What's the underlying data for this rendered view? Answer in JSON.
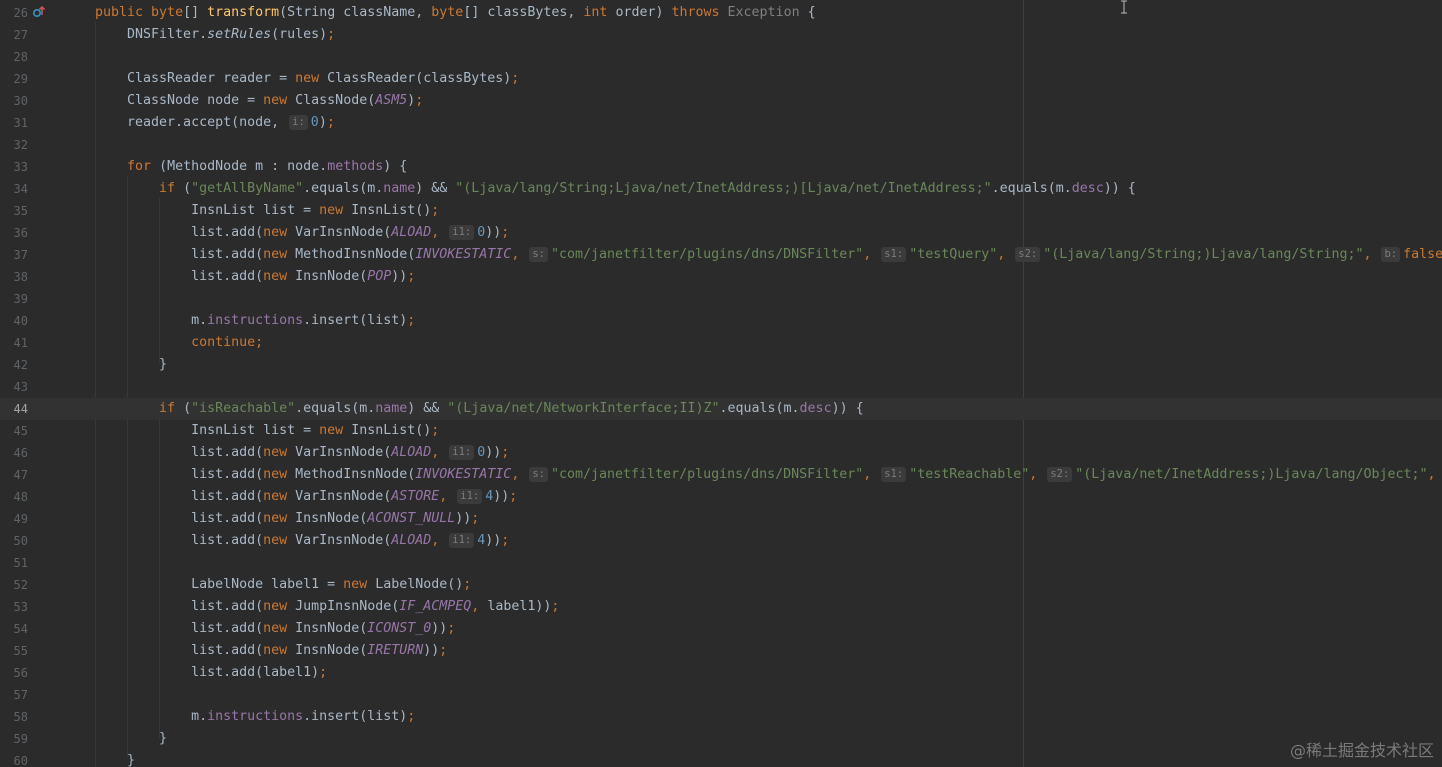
{
  "editor": {
    "watermark": "@稀土掘金技术社区",
    "current_line_index": 18,
    "gutter_icon": "implements-override-icon",
    "colors": {
      "background": "#2b2b2b",
      "keyword": "#cc7832",
      "string": "#6a8759",
      "method_declaration": "#ffc66d",
      "field": "#9876aa",
      "number": "#6897bb",
      "plain": "#a9b7c6",
      "line_number": "#606366"
    },
    "lines": [
      {
        "num": "26",
        "tokens": [
          {
            "c": "kw",
            "t": "public "
          },
          {
            "c": "kw",
            "t": "byte"
          },
          {
            "t": "[] "
          },
          {
            "c": "fn",
            "t": "transform"
          },
          {
            "t": "(String className, "
          },
          {
            "c": "kw",
            "t": "byte"
          },
          {
            "t": "[] classBytes, "
          },
          {
            "c": "kw",
            "t": "int "
          },
          {
            "t": "order) "
          },
          {
            "c": "kw",
            "t": "throws "
          },
          {
            "c": "cmt",
            "t": "Exception"
          },
          {
            "t": " {"
          }
        ]
      },
      {
        "num": "27",
        "tokens": [
          {
            "t": "    DNSFilter."
          },
          {
            "c": "st",
            "t": "setRules"
          },
          {
            "t": "(rules)"
          },
          {
            "c": "kw",
            "t": ";"
          }
        ]
      },
      {
        "num": "28",
        "tokens": []
      },
      {
        "num": "29",
        "tokens": [
          {
            "t": "    ClassReader reader = "
          },
          {
            "c": "kw",
            "t": "new "
          },
          {
            "t": "ClassReader(classBytes)"
          },
          {
            "c": "kw",
            "t": ";"
          }
        ]
      },
      {
        "num": "30",
        "tokens": [
          {
            "t": "    ClassNode node = "
          },
          {
            "c": "kw",
            "t": "new "
          },
          {
            "t": "ClassNode("
          },
          {
            "c": "cst",
            "t": "ASM5"
          },
          {
            "t": ")"
          },
          {
            "c": "kw",
            "t": ";"
          }
        ]
      },
      {
        "num": "31",
        "tokens": [
          {
            "t": "    reader.accept(node, "
          },
          {
            "c": "hint",
            "t": "i:"
          },
          {
            "c": "num",
            "t": "0"
          },
          {
            "t": ")"
          },
          {
            "c": "kw",
            "t": ";"
          }
        ]
      },
      {
        "num": "32",
        "tokens": []
      },
      {
        "num": "33",
        "tokens": [
          {
            "t": "    "
          },
          {
            "c": "kw",
            "t": "for "
          },
          {
            "t": "(MethodNode m : node."
          },
          {
            "c": "fld",
            "t": "methods"
          },
          {
            "t": ") {"
          }
        ]
      },
      {
        "num": "34",
        "tokens": [
          {
            "t": "        "
          },
          {
            "c": "kw",
            "t": "if "
          },
          {
            "t": "("
          },
          {
            "c": "str",
            "t": "\"getAllByName\""
          },
          {
            "t": ".equals(m."
          },
          {
            "c": "fld",
            "t": "name"
          },
          {
            "t": ") && "
          },
          {
            "c": "str",
            "t": "\"(Ljava/lang/String;Ljava/net/InetAddress;)[Ljava/net/InetAddress;\""
          },
          {
            "t": ".equals(m."
          },
          {
            "c": "fld",
            "t": "desc"
          },
          {
            "t": ")) {"
          }
        ]
      },
      {
        "num": "35",
        "tokens": [
          {
            "t": "            InsnList list = "
          },
          {
            "c": "kw",
            "t": "new "
          },
          {
            "t": "InsnList()"
          },
          {
            "c": "kw",
            "t": ";"
          }
        ]
      },
      {
        "num": "36",
        "tokens": [
          {
            "t": "            list.add("
          },
          {
            "c": "kw",
            "t": "new "
          },
          {
            "t": "VarInsnNode("
          },
          {
            "c": "cst",
            "t": "ALOAD"
          },
          {
            "c": "kw",
            "t": ", "
          },
          {
            "c": "hint",
            "t": "i1:"
          },
          {
            "c": "num",
            "t": "0"
          },
          {
            "t": "))"
          },
          {
            "c": "kw",
            "t": ";"
          }
        ]
      },
      {
        "num": "37",
        "tokens": [
          {
            "t": "            list.add("
          },
          {
            "c": "kw",
            "t": "new "
          },
          {
            "t": "MethodInsnNode("
          },
          {
            "c": "cst",
            "t": "INVOKESTATIC"
          },
          {
            "c": "kw",
            "t": ", "
          },
          {
            "c": "hint",
            "t": "s:"
          },
          {
            "c": "str",
            "t": "\"com/janetfilter/plugins/dns/DNSFilter\""
          },
          {
            "c": "kw",
            "t": ", "
          },
          {
            "c": "hint",
            "t": "s1:"
          },
          {
            "c": "str",
            "t": "\"testQuery\""
          },
          {
            "c": "kw",
            "t": ", "
          },
          {
            "c": "hint",
            "t": "s2:"
          },
          {
            "c": "str",
            "t": "\"(Ljava/lang/String;)Ljava/lang/String;\""
          },
          {
            "c": "kw",
            "t": ", "
          },
          {
            "c": "hint",
            "t": "b:"
          },
          {
            "c": "kw",
            "t": "false"
          }
        ]
      },
      {
        "num": "38",
        "tokens": [
          {
            "t": "            list.add("
          },
          {
            "c": "kw",
            "t": "new "
          },
          {
            "t": "InsnNode("
          },
          {
            "c": "cst",
            "t": "POP"
          },
          {
            "t": "))"
          },
          {
            "c": "kw",
            "t": ";"
          }
        ]
      },
      {
        "num": "39",
        "tokens": []
      },
      {
        "num": "40",
        "tokens": [
          {
            "t": "            m."
          },
          {
            "c": "fld",
            "t": "instructions"
          },
          {
            "t": ".insert(list)"
          },
          {
            "c": "kw",
            "t": ";"
          }
        ]
      },
      {
        "num": "41",
        "tokens": [
          {
            "t": "            "
          },
          {
            "c": "kw",
            "t": "continue;"
          }
        ]
      },
      {
        "num": "42",
        "tokens": [
          {
            "t": "        }"
          }
        ]
      },
      {
        "num": "43",
        "tokens": []
      },
      {
        "num": "44",
        "tokens": [
          {
            "t": "        "
          },
          {
            "c": "kw",
            "t": "if "
          },
          {
            "t": "("
          },
          {
            "c": "str",
            "t": "\"isReachable\""
          },
          {
            "t": ".equals(m."
          },
          {
            "c": "fld",
            "t": "name"
          },
          {
            "t": ") && "
          },
          {
            "c": "str",
            "t": "\"(Ljava/net/NetworkInterface;II)Z\""
          },
          {
            "t": ".equals(m."
          },
          {
            "c": "fld",
            "t": "desc"
          },
          {
            "t": ")) {"
          }
        ]
      },
      {
        "num": "45",
        "tokens": [
          {
            "t": "            InsnList list = "
          },
          {
            "c": "kw",
            "t": "new "
          },
          {
            "t": "InsnList()"
          },
          {
            "c": "kw",
            "t": ";"
          }
        ]
      },
      {
        "num": "46",
        "tokens": [
          {
            "t": "            list.add("
          },
          {
            "c": "kw",
            "t": "new "
          },
          {
            "t": "VarInsnNode("
          },
          {
            "c": "cst",
            "t": "ALOAD"
          },
          {
            "c": "kw",
            "t": ", "
          },
          {
            "c": "hint",
            "t": "i1:"
          },
          {
            "c": "num",
            "t": "0"
          },
          {
            "t": "))"
          },
          {
            "c": "kw",
            "t": ";"
          }
        ]
      },
      {
        "num": "47",
        "tokens": [
          {
            "t": "            list.add("
          },
          {
            "c": "kw",
            "t": "new "
          },
          {
            "t": "MethodInsnNode("
          },
          {
            "c": "cst",
            "t": "INVOKESTATIC"
          },
          {
            "c": "kw",
            "t": ", "
          },
          {
            "c": "hint",
            "t": "s:"
          },
          {
            "c": "str",
            "t": "\"com/janetfilter/plugins/dns/DNSFilter\""
          },
          {
            "c": "kw",
            "t": ", "
          },
          {
            "c": "hint",
            "t": "s1:"
          },
          {
            "c": "str",
            "t": "\"testReachable\""
          },
          {
            "c": "kw",
            "t": ", "
          },
          {
            "c": "hint",
            "t": "s2:"
          },
          {
            "c": "str",
            "t": "\"(Ljava/net/InetAddress;)Ljava/lang/Object;\""
          },
          {
            "c": "kw",
            "t": ","
          }
        ]
      },
      {
        "num": "48",
        "tokens": [
          {
            "t": "            list.add("
          },
          {
            "c": "kw",
            "t": "new "
          },
          {
            "t": "VarInsnNode("
          },
          {
            "c": "cst",
            "t": "ASTORE"
          },
          {
            "c": "kw",
            "t": ", "
          },
          {
            "c": "hint",
            "t": "i1:"
          },
          {
            "c": "num",
            "t": "4"
          },
          {
            "t": "))"
          },
          {
            "c": "kw",
            "t": ";"
          }
        ]
      },
      {
        "num": "49",
        "tokens": [
          {
            "t": "            list.add("
          },
          {
            "c": "kw",
            "t": "new "
          },
          {
            "t": "InsnNode("
          },
          {
            "c": "cst",
            "t": "ACONST_NULL"
          },
          {
            "t": "))"
          },
          {
            "c": "kw",
            "t": ";"
          }
        ]
      },
      {
        "num": "50",
        "tokens": [
          {
            "t": "            list.add("
          },
          {
            "c": "kw",
            "t": "new "
          },
          {
            "t": "VarInsnNode("
          },
          {
            "c": "cst",
            "t": "ALOAD"
          },
          {
            "c": "kw",
            "t": ", "
          },
          {
            "c": "hint",
            "t": "i1:"
          },
          {
            "c": "num",
            "t": "4"
          },
          {
            "t": "))"
          },
          {
            "c": "kw",
            "t": ";"
          }
        ]
      },
      {
        "num": "51",
        "tokens": []
      },
      {
        "num": "52",
        "tokens": [
          {
            "t": "            LabelNode label1 = "
          },
          {
            "c": "kw",
            "t": "new "
          },
          {
            "t": "LabelNode()"
          },
          {
            "c": "kw",
            "t": ";"
          }
        ]
      },
      {
        "num": "53",
        "tokens": [
          {
            "t": "            list.add("
          },
          {
            "c": "kw",
            "t": "new "
          },
          {
            "t": "JumpInsnNode("
          },
          {
            "c": "cst",
            "t": "IF_ACMPEQ"
          },
          {
            "c": "kw",
            "t": ", "
          },
          {
            "t": "label1))"
          },
          {
            "c": "kw",
            "t": ";"
          }
        ]
      },
      {
        "num": "54",
        "tokens": [
          {
            "t": "            list.add("
          },
          {
            "c": "kw",
            "t": "new "
          },
          {
            "t": "InsnNode("
          },
          {
            "c": "cst",
            "t": "ICONST_0"
          },
          {
            "t": "))"
          },
          {
            "c": "kw",
            "t": ";"
          }
        ]
      },
      {
        "num": "55",
        "tokens": [
          {
            "t": "            list.add("
          },
          {
            "c": "kw",
            "t": "new "
          },
          {
            "t": "InsnNode("
          },
          {
            "c": "cst",
            "t": "IRETURN"
          },
          {
            "t": "))"
          },
          {
            "c": "kw",
            "t": ";"
          }
        ]
      },
      {
        "num": "56",
        "tokens": [
          {
            "t": "            list.add(label1)"
          },
          {
            "c": "kw",
            "t": ";"
          }
        ]
      },
      {
        "num": "57",
        "tokens": []
      },
      {
        "num": "58",
        "tokens": [
          {
            "t": "            m."
          },
          {
            "c": "fld",
            "t": "instructions"
          },
          {
            "t": ".insert(list)"
          },
          {
            "c": "kw",
            "t": ";"
          }
        ]
      },
      {
        "num": "59",
        "tokens": [
          {
            "t": "        }"
          }
        ]
      },
      {
        "num": "60",
        "tokens": [
          {
            "t": "    }"
          }
        ]
      }
    ]
  }
}
